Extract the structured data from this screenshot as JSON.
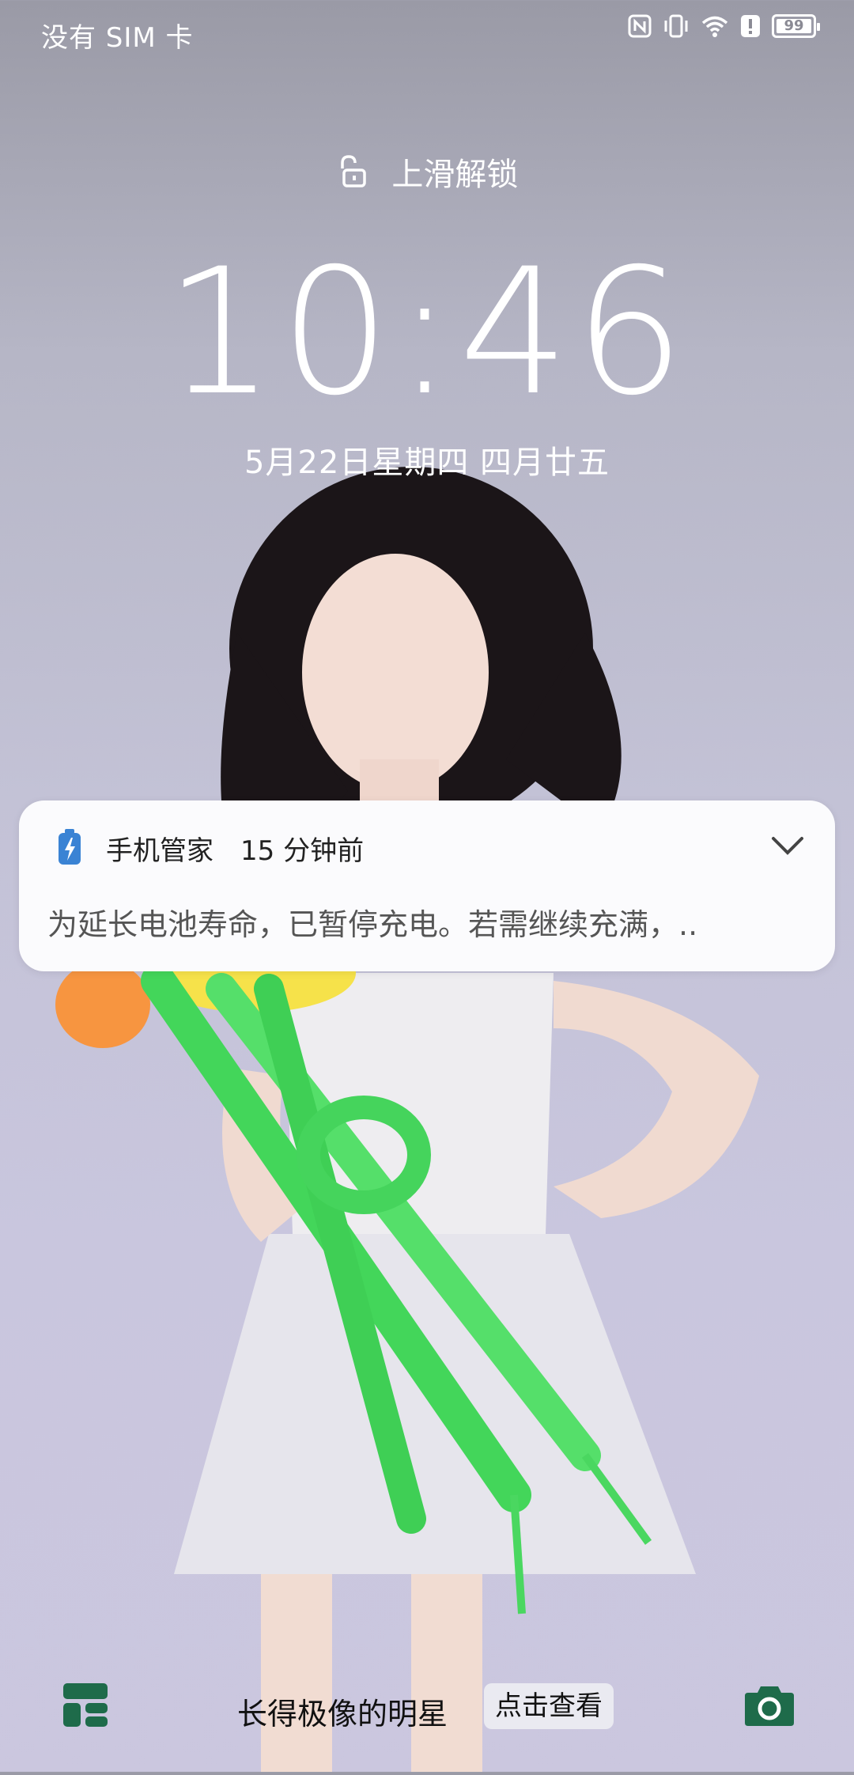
{
  "status_bar": {
    "carrier": "没有 SIM 卡",
    "battery_level": "99",
    "icons": [
      "nfc-icon",
      "vibrate-icon",
      "wifi-icon",
      "alert-icon",
      "battery-icon"
    ]
  },
  "lockscreen": {
    "unlock_hint": "上滑解锁",
    "time": "10:46",
    "date": "5月22日星期四  四月廿五"
  },
  "notification": {
    "app_name": "手机管家",
    "time_ago": "15 分钟前",
    "body": "为延长电池寿命，已暂停充电。若需继续充满，..",
    "app_icon": "battery-charging-icon"
  },
  "bottom_bar": {
    "caption": "长得极像的明星",
    "action": "点击查看",
    "left_icon": "widget-icon",
    "right_icon": "camera-icon",
    "icon_color": "#1e6b4a"
  }
}
